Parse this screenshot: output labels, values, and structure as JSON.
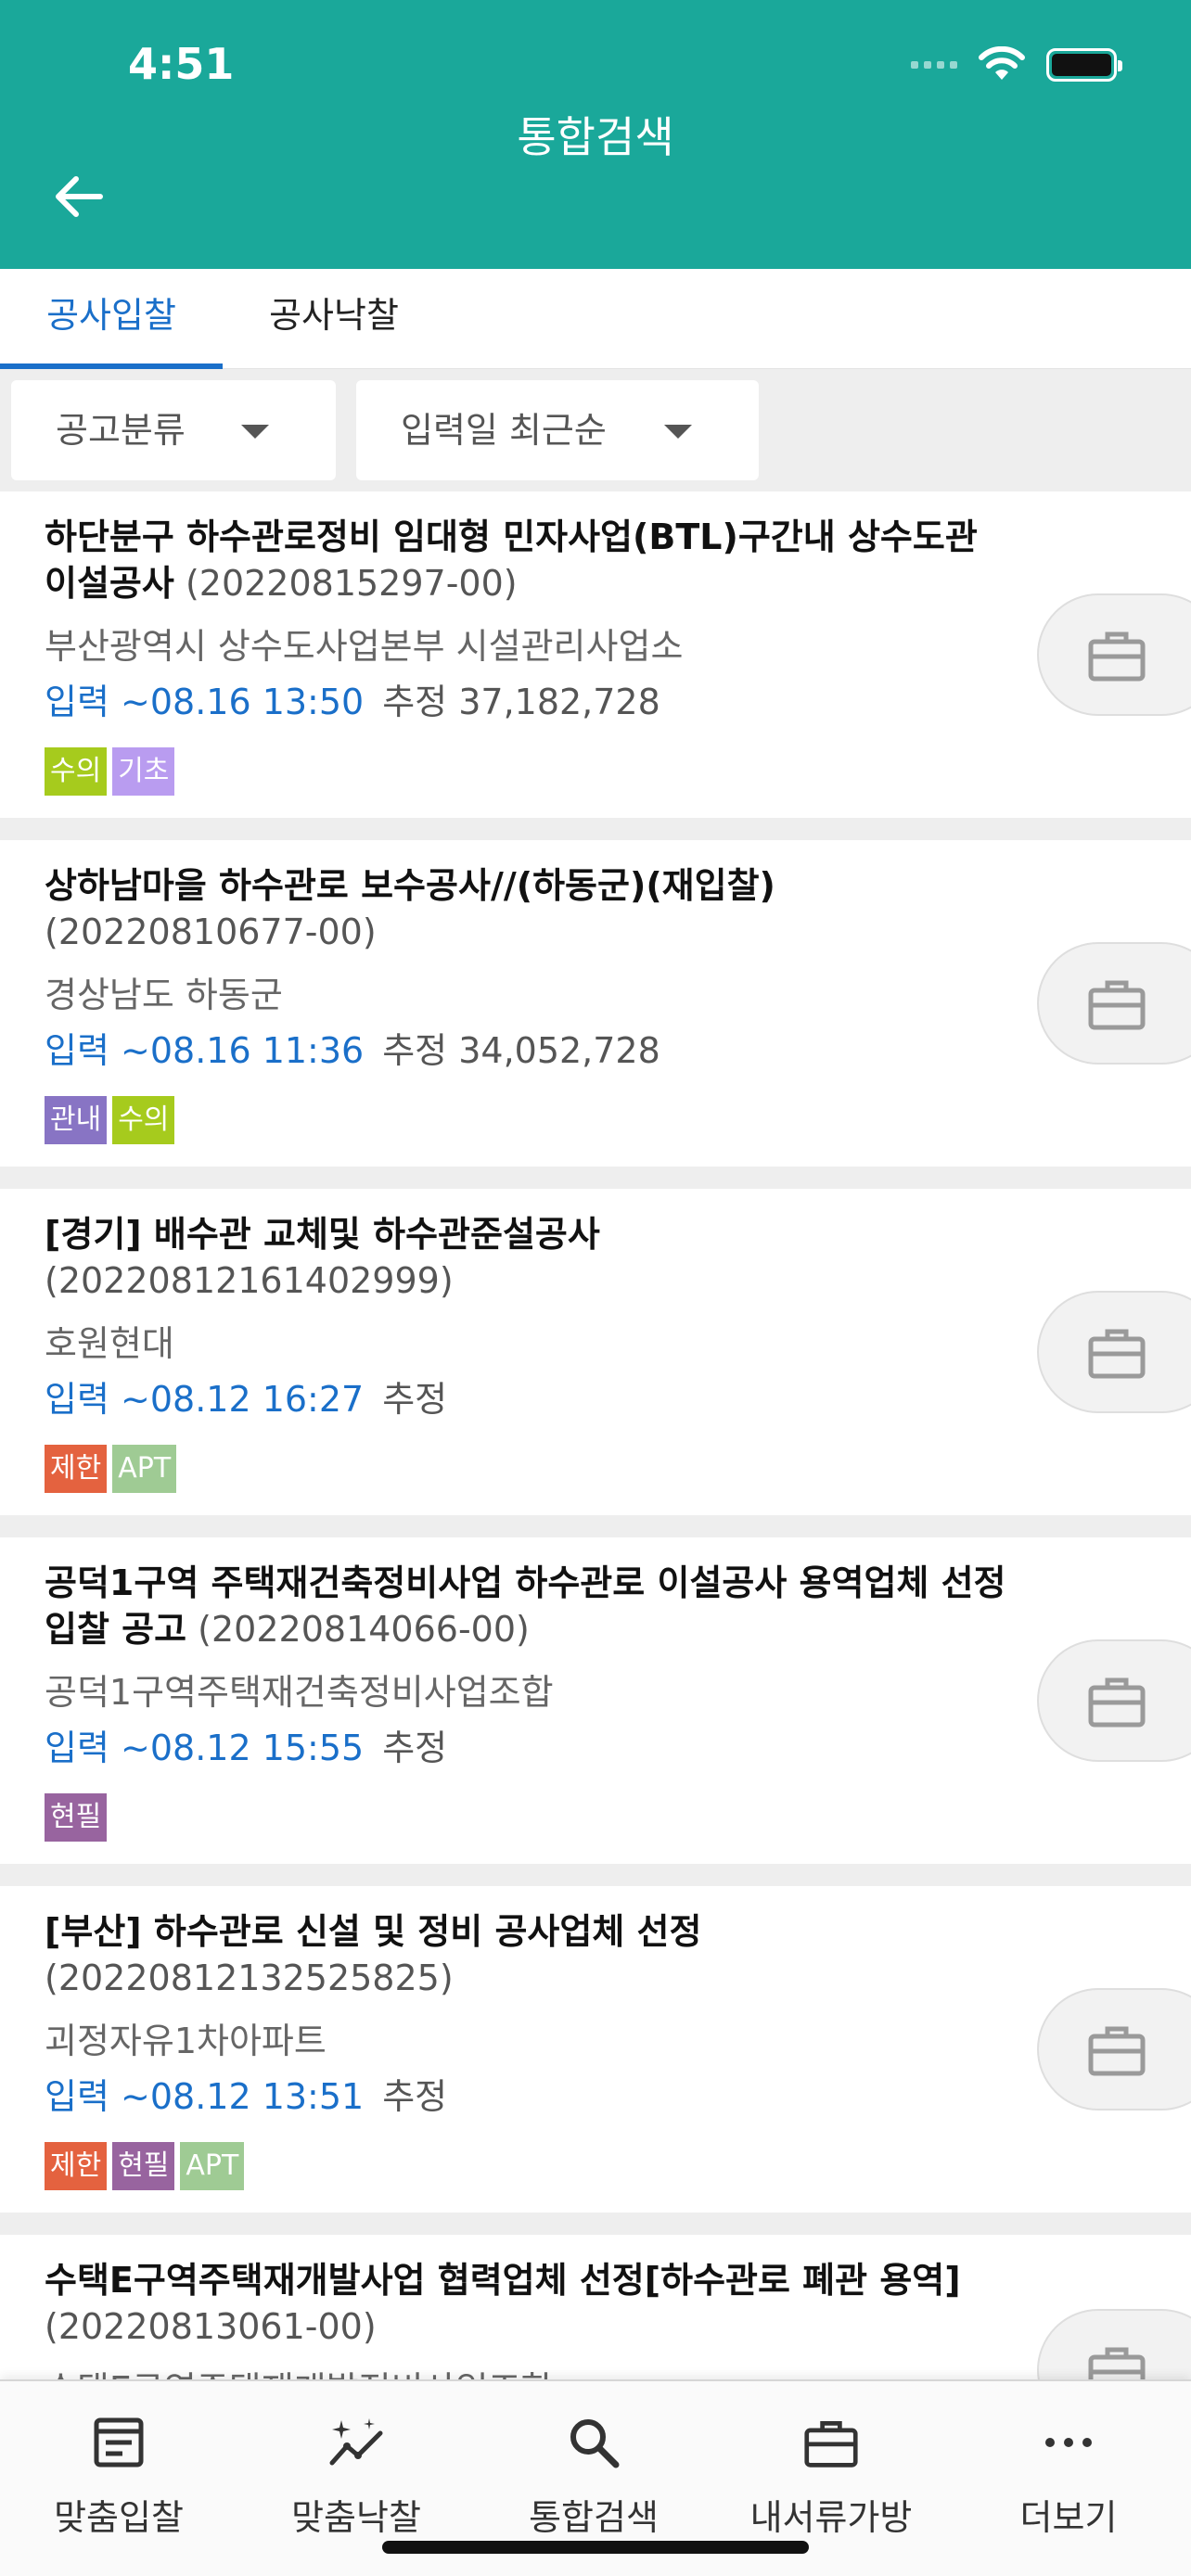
{
  "status_bar": {
    "time": "4:51"
  },
  "header": {
    "title": "통합검색"
  },
  "tabs": [
    {
      "label": "공사입찰",
      "active": true
    },
    {
      "label": "공사낙찰",
      "active": false
    }
  ],
  "filters": {
    "category": "공고분류",
    "sort": "입력일 최근순"
  },
  "tag_colors": {
    "수의": "#a6cb1d",
    "기초": "#b99cf0",
    "관내": "#8874c4",
    "제한": "#e4623f",
    "APT": "#9fcb94",
    "현필": "#98649f"
  },
  "items": [
    {
      "title": "하단분구 하수관로정비 임대형 민자사업(BTL)구간내 상수도관 이설공사",
      "code": "(20220815297-00)",
      "agency": "부산광역시 상수도사업본부 시설관리사업소",
      "date": "입력 ~08.16 13:50",
      "estimate": "추정 37,182,728",
      "tags": [
        "수의",
        "기초"
      ]
    },
    {
      "title": "상하남마을 하수관로 보수공사//(하동군)(재입찰)",
      "code": "(20220810677-00)",
      "agency": "경상남도 하동군",
      "date": "입력 ~08.16 11:36",
      "estimate": "추정 34,052,728",
      "tags": [
        "관내",
        "수의"
      ]
    },
    {
      "title": "[경기] 배수관 교체및 하수관준설공사",
      "code": "(20220812161402999)",
      "agency": "호원현대",
      "date": "입력 ~08.12 16:27",
      "estimate": "추정",
      "tags": [
        "제한",
        "APT"
      ]
    },
    {
      "title": "공덕1구역 주택재건축정비사업 하수관로 이설공사 용역업체 선정 입찰 공고",
      "code": "(20220814066-00)",
      "agency": "공덕1구역주택재건축정비사업조합",
      "date": "입력 ~08.12 15:55",
      "estimate": "추정",
      "tags": [
        "현필"
      ]
    },
    {
      "title": "[부산] 하수관로 신설 및 정비 공사업체 선정",
      "code": "(20220812132525825)",
      "agency": "괴정자유1차아파트",
      "date": "입력 ~08.12 13:51",
      "estimate": "추정",
      "tags": [
        "제한",
        "현필",
        "APT"
      ]
    },
    {
      "title": "수택E구역주택재개발사업 협력업체 선정[하수관로 폐관 용역]",
      "code": "(20220813061-00)",
      "agency": "수택E구역주택재개발정비사업조합",
      "date": "",
      "estimate": "",
      "tags": []
    }
  ],
  "bottom_nav": [
    {
      "label": "맞춤입찰",
      "icon": "document-icon"
    },
    {
      "label": "맞춤낙찰",
      "icon": "trend-sparkle-icon"
    },
    {
      "label": "통합검색",
      "icon": "search-icon"
    },
    {
      "label": "내서류가방",
      "icon": "briefcase-icon"
    },
    {
      "label": "더보기",
      "icon": "more-icon"
    }
  ]
}
